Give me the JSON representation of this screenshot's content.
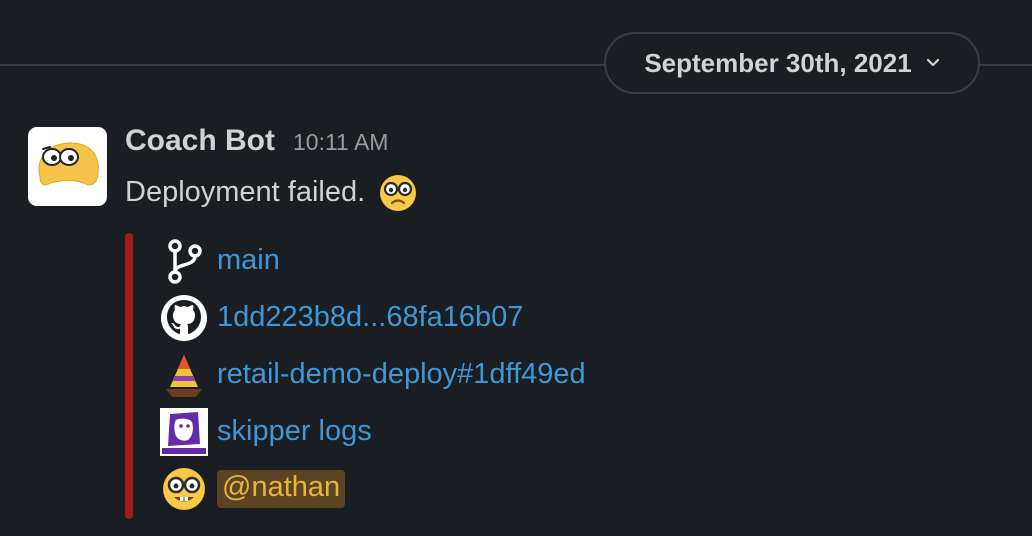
{
  "date_divider": {
    "label": "September 30th, 2021",
    "icon": "chevron-down-icon"
  },
  "message": {
    "sender": "Coach Bot",
    "time": "10:11 AM",
    "text": "Deployment failed.",
    "text_emoji": "frowning-nerd-emoji",
    "attachment": {
      "bar_color": "#a11c1c",
      "rows": [
        {
          "icon": "git-branch-icon",
          "text": "main"
        },
        {
          "icon": "github-icon",
          "text": "1dd223b8d...68fa16b07"
        },
        {
          "icon": "sailboat-icon",
          "text": "retail-demo-deploy#1dff49ed"
        },
        {
          "icon": "datadog-icon",
          "text": "skipper logs"
        },
        {
          "icon": "nerd-face-icon",
          "text": "@nathan"
        }
      ]
    }
  },
  "colors": {
    "background": "#1a1d21",
    "link": "#3f97d6",
    "mention_text": "#e8b43a",
    "mention_bg": "#5b4423"
  }
}
